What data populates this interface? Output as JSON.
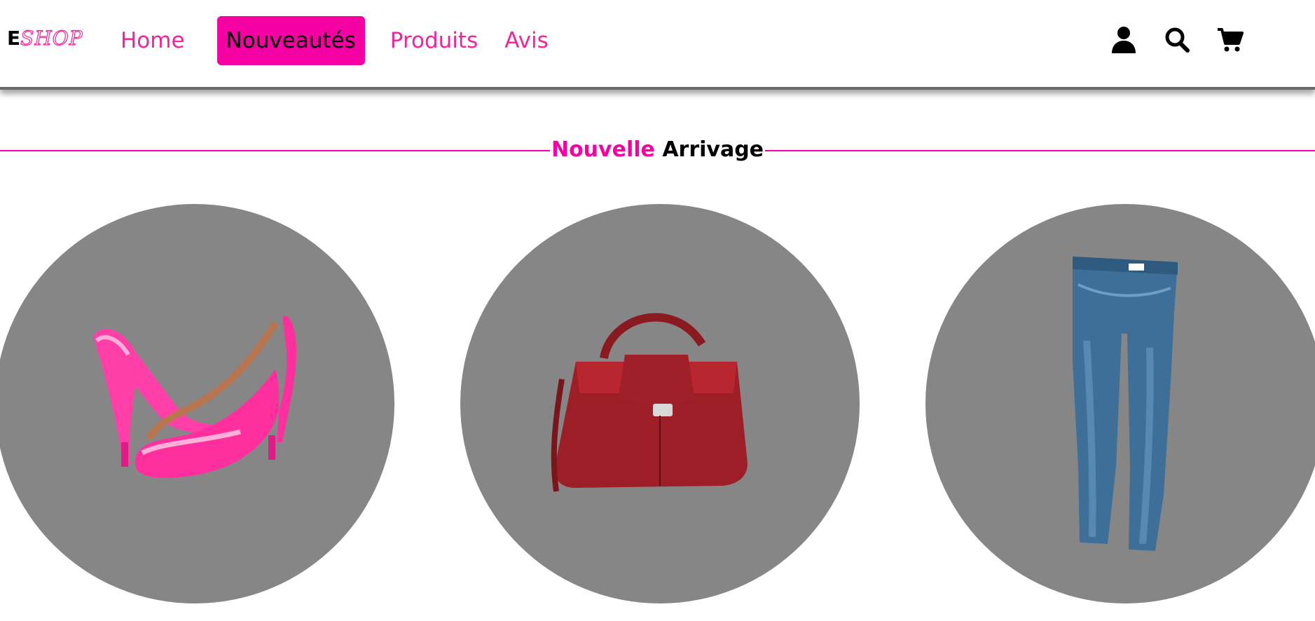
{
  "logo": {
    "letter": "E",
    "script": "SHOP"
  },
  "nav": {
    "home": "Home",
    "new": "Nouveautés",
    "products": "Produits",
    "reviews": "Avis"
  },
  "header_icons": [
    "user-icon",
    "search-icon",
    "cart-icon"
  ],
  "section": {
    "title_pink": "Nouvelle",
    "title_black": "Arrivage"
  },
  "products": [
    {
      "image": "pink-high-heels"
    },
    {
      "image": "red-leather-handbag"
    },
    {
      "image": "blue-jeans"
    }
  ],
  "colors": {
    "accent": "#f500a2",
    "link": "#f0249b",
    "circle": "#868686"
  }
}
